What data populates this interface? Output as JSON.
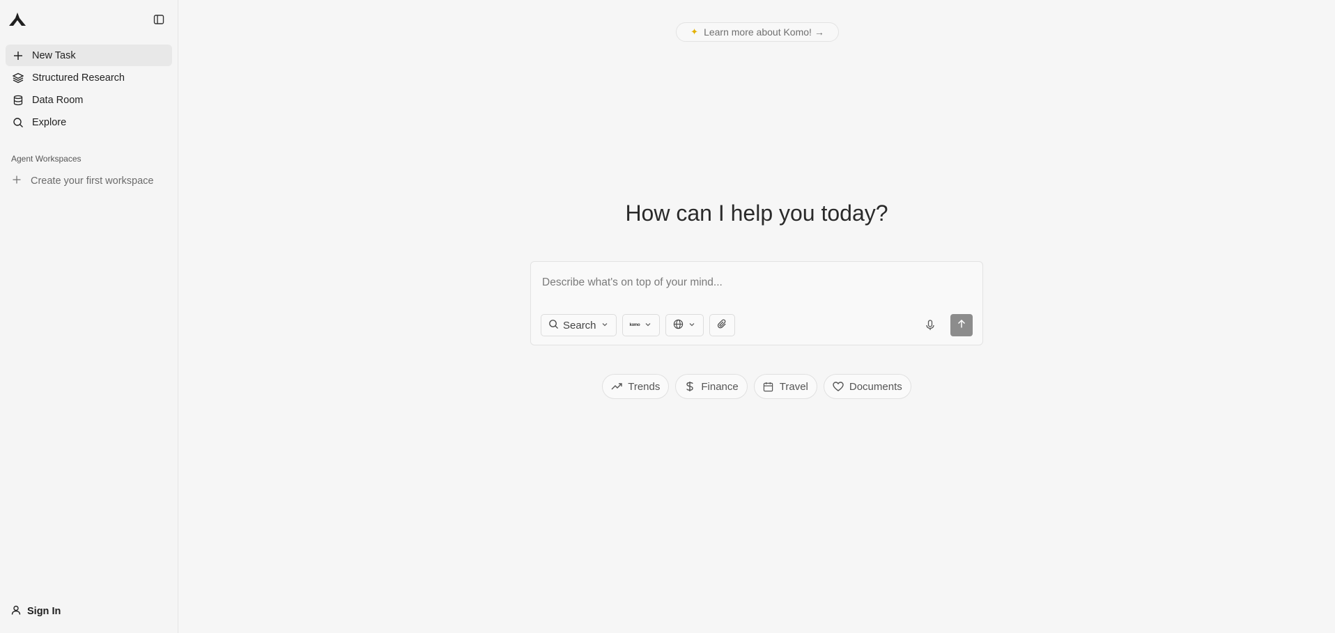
{
  "sidebar": {
    "items": [
      {
        "label": "New Task",
        "icon": "plus-icon",
        "active": true
      },
      {
        "label": "Structured Research",
        "icon": "layers-icon"
      },
      {
        "label": "Data Room",
        "icon": "database-icon"
      },
      {
        "label": "Explore",
        "icon": "search-icon"
      }
    ],
    "section_label": "Agent Workspaces",
    "create_workspace": "Create your first workspace",
    "sign_in": "Sign In"
  },
  "main": {
    "learn_more": "Learn more about Komo! →",
    "headline": "How can I help you today?",
    "composer": {
      "placeholder": "Describe what's on top of your mind...",
      "search_label": "Search",
      "model_badge": "komo"
    },
    "chips": [
      {
        "label": "Trends",
        "icon": "trending-up-icon"
      },
      {
        "label": "Finance",
        "icon": "dollar-icon"
      },
      {
        "label": "Travel",
        "icon": "calendar-icon"
      },
      {
        "label": "Documents",
        "icon": "heart-icon"
      }
    ]
  },
  "colors": {
    "background": "#f6f6f6",
    "accent_sparkle": "#e3b106",
    "send_button": "#8c8c8c"
  }
}
